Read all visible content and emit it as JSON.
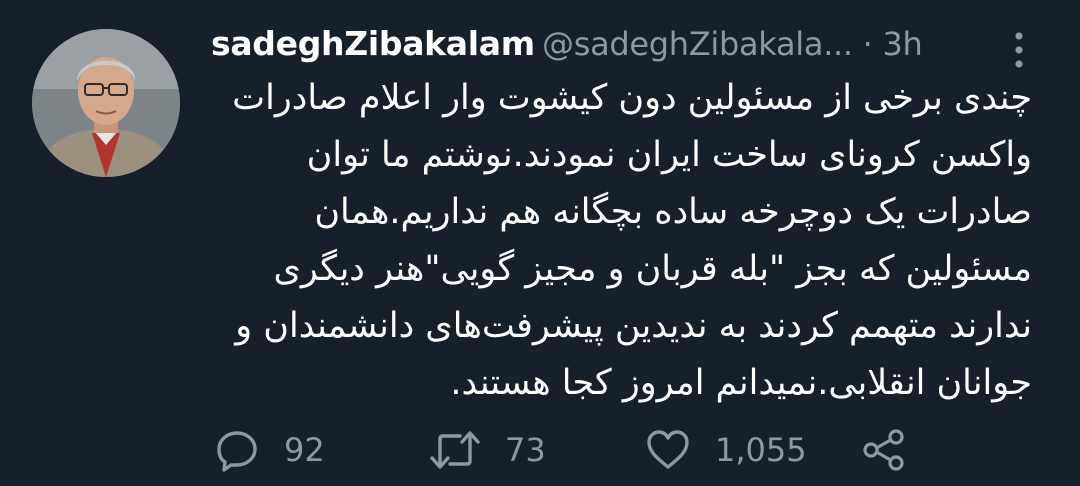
{
  "tweet": {
    "display_name": "sadeghZibakalam",
    "handle": "@sadeghZibakala...",
    "separator": " · ",
    "time": "3h",
    "text": "چندی برخی از مسئولین دون کیشوت وار اعلام صادرات\nواکسن کرونای ساخت ایران نمودند.نوشتم ما توان\nصادرات یک دوچرخه ساده بچگانه هم نداریم.همان\nمسئولین که بجز \"بله قربان و مجیز گویی\"هنر دیگری\nندارند متهمم کردند به ندیدین پیشرفت‌های دانشمندان و\nجوانان انقلابی.نمیدانم امروز کجا هستند."
  },
  "actions": {
    "replies": "92",
    "retweets": "73",
    "likes": "1,055"
  },
  "colors": {
    "background": "#15202b",
    "primary_text": "#ffffff",
    "secondary_text": "#8b98a5"
  },
  "icons": {
    "more": "vertical-dots-icon",
    "reply": "speech-bubble-icon",
    "retweet": "retweet-arrows-icon",
    "like": "heart-icon",
    "share": "share-nodes-icon"
  }
}
